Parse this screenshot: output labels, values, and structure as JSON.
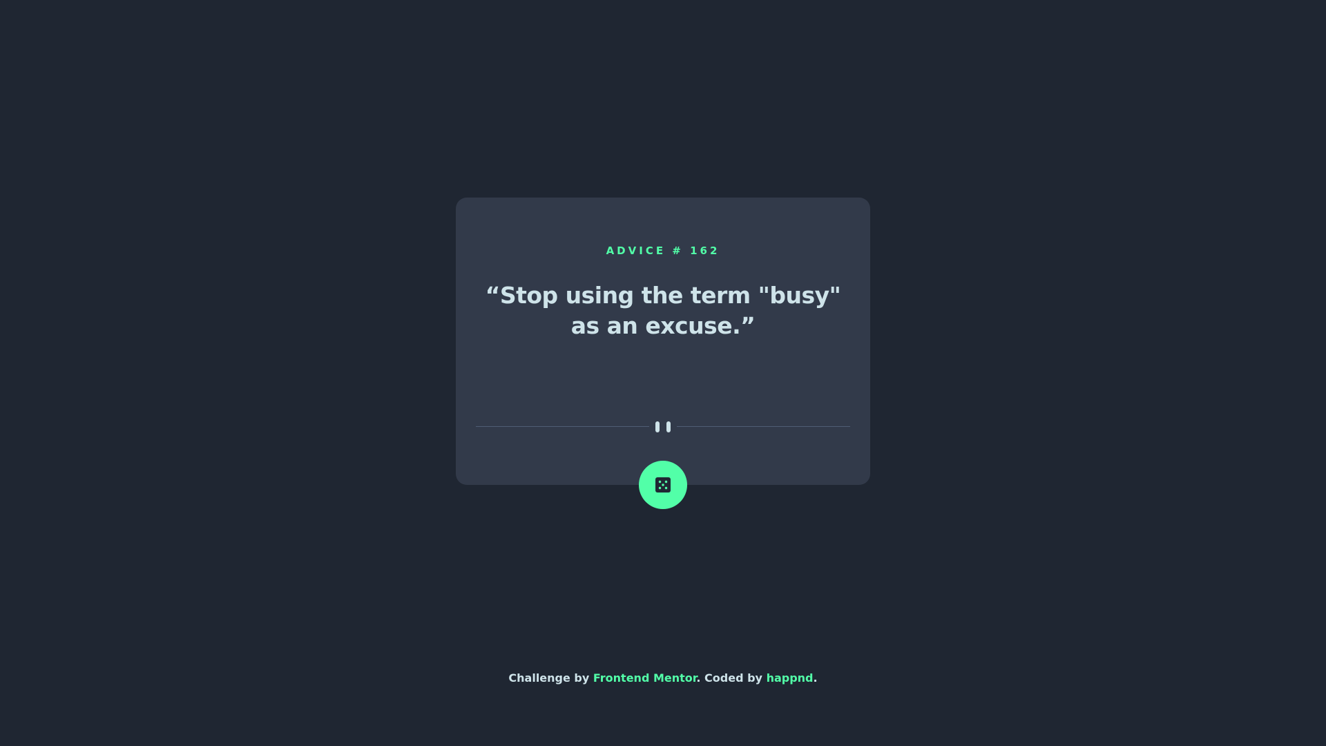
{
  "card": {
    "advice_label": "ADVICE # 162",
    "quote": "“Stop using the term \"busy\" as an excuse.”",
    "divider_icon": "pause-icon",
    "button_icon": "dice-icon"
  },
  "footer": {
    "prefix": "Challenge by ",
    "challenge_link": "Frontend Mentor",
    "middle": ". Coded by ",
    "author_link": "happnd",
    "suffix": "."
  },
  "colors": {
    "background": "#1f2632",
    "card": "#323a4a",
    "accent": "#52ffa8",
    "text": "#cee3e9",
    "divider": "#4f5d74"
  }
}
